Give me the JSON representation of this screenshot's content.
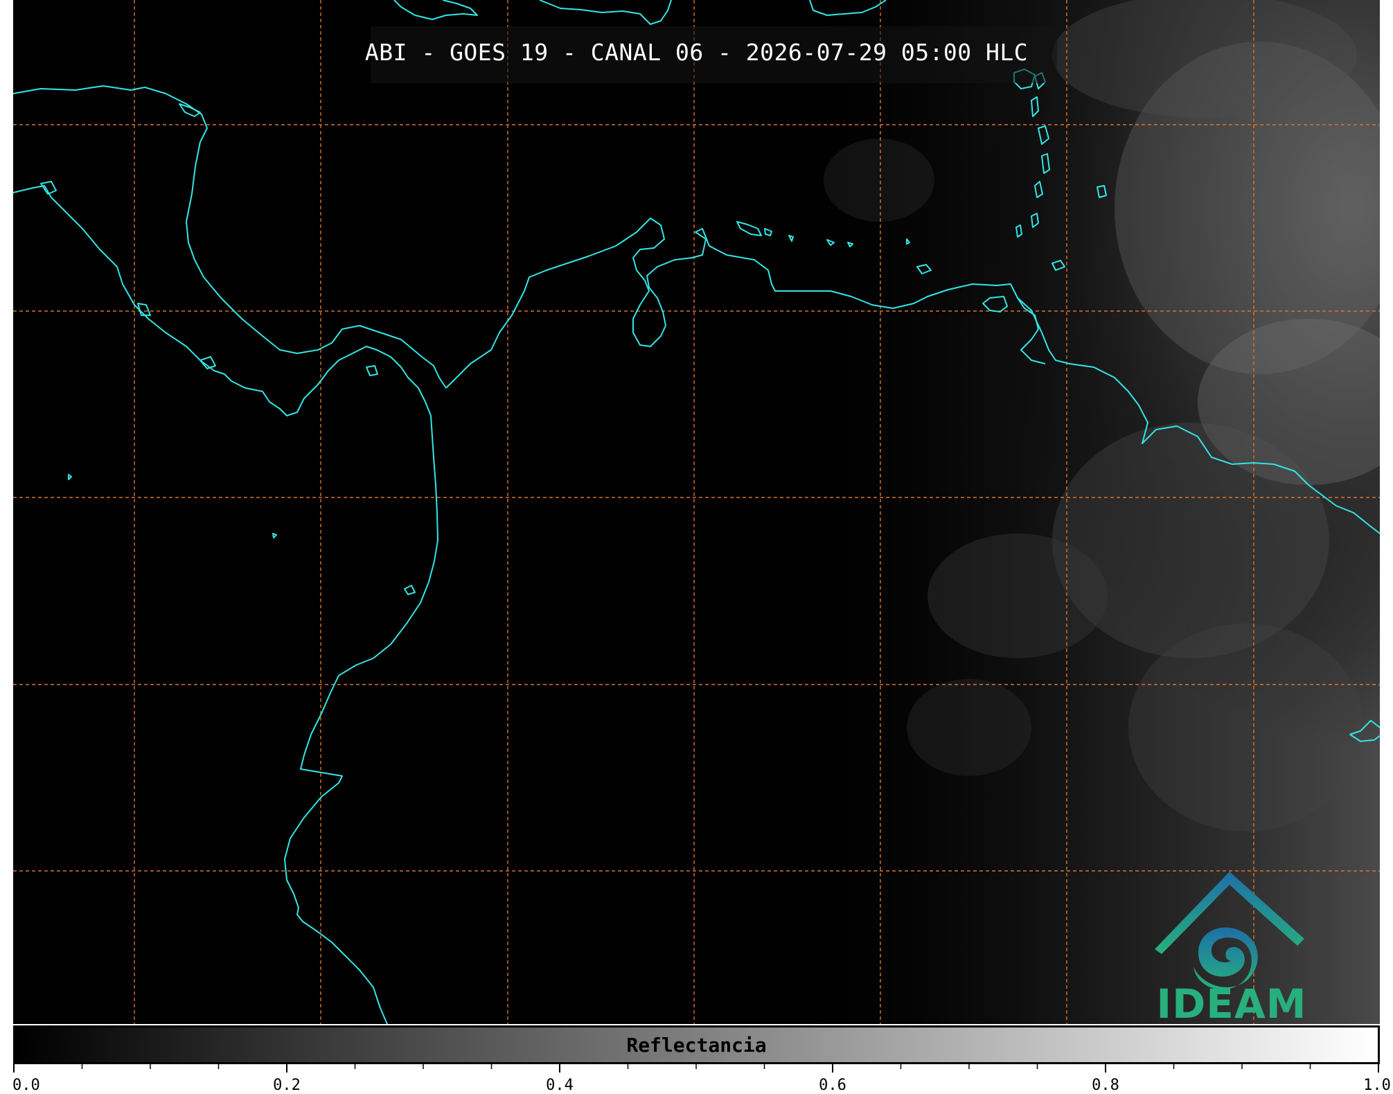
{
  "header": {
    "title": "ABI - GOES 19 - CANAL 06 - 2026-07-29 05:00 HLC"
  },
  "logo": {
    "text": "IDEAM"
  },
  "colorbar": {
    "label": "Reflectancia",
    "tick_labels": [
      "0.0",
      "0.2",
      "0.4",
      "0.6",
      "0.8",
      "1.0"
    ],
    "range": [
      0.0,
      1.0
    ],
    "colormap": "gray",
    "colormap_start": "#000000",
    "colormap_end": "#ffffff"
  },
  "colors": {
    "background": "#000000",
    "coastline": "#33e6e6",
    "gridline": "#d9742a",
    "logo_primary": "#27b07e",
    "logo_secondary": "#1e6fa8"
  }
}
